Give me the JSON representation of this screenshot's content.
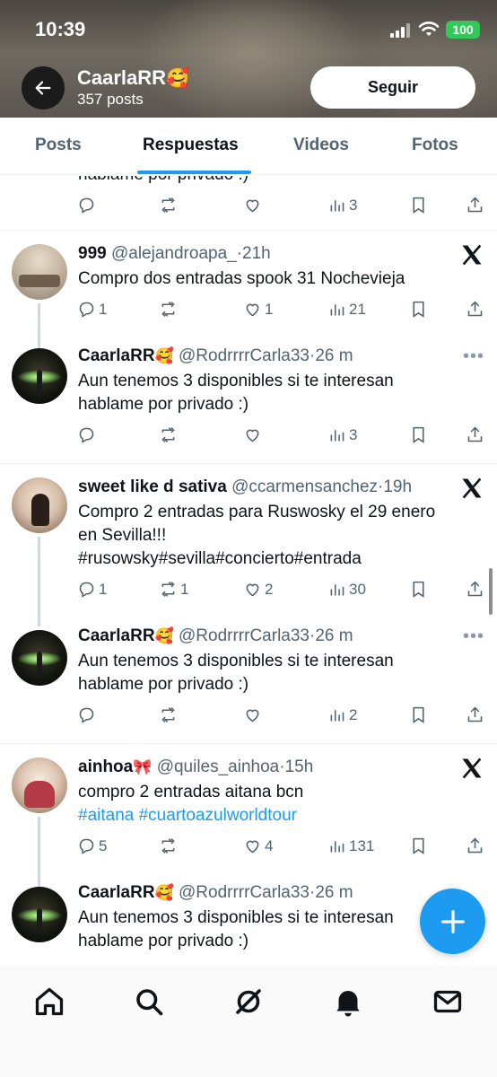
{
  "status_bar": {
    "time": "10:39",
    "battery": "100"
  },
  "profile": {
    "name": "CaarlaRR",
    "name_emoji": "🥰",
    "posts_count": "357 posts",
    "follow_label": "Seguir"
  },
  "tabs": [
    {
      "label": "Posts",
      "active": false
    },
    {
      "label": "Respuestas",
      "active": true
    },
    {
      "label": "Videos",
      "active": false
    },
    {
      "label": "Fotos",
      "active": false
    }
  ],
  "feed": {
    "top_partial": {
      "text": "hablame por privado :)",
      "views": "3"
    },
    "threads": [
      {
        "original": {
          "name": "999",
          "name_emoji": "",
          "handle": "@alejandroapa_",
          "time": "21h",
          "lines": [
            "Compro dos entradas spook 31 Nochevieja"
          ],
          "replies": "1",
          "reposts": "",
          "likes": "1",
          "views": "21"
        },
        "reply": {
          "name": "CaarlaRR",
          "name_emoji": "🥰",
          "handle": "@RodrrrrCarla33",
          "time": "26 m",
          "lines": [
            "Aun tenemos 3 disponibles si te interesan",
            "hablame por privado :)"
          ],
          "views": "3"
        }
      },
      {
        "original": {
          "name": "sweet like d sativa",
          "name_emoji": "",
          "handle": "@ccarmensanchez",
          "time": "19h",
          "lines": [
            "Compro 2 entradas para Ruswosky el 29 enero",
            "en Sevilla!!!",
            "#rusowsky#sevilla#concierto#entrada"
          ],
          "replies": "1",
          "reposts": "1",
          "likes": "2",
          "views": "30"
        },
        "reply": {
          "name": "CaarlaRR",
          "name_emoji": "🥰",
          "handle": "@RodrrrrCarla33",
          "time": "26 m",
          "lines": [
            "Aun tenemos 3 disponibles si te interesan",
            "hablame por privado :)"
          ],
          "views": "2"
        }
      },
      {
        "original": {
          "name": "ainhoa",
          "name_emoji": "🎀",
          "handle": "@quiles_ainhoa",
          "time": "15h",
          "lines": [
            "compro 2 entradas aitana bcn"
          ],
          "hashtags": "#aitana #cuartoazulworldtour",
          "replies": "5",
          "reposts": "",
          "likes": "4",
          "views": "131"
        },
        "reply": {
          "name": "CaarlaRR",
          "name_emoji": "🥰",
          "handle": "@RodrrrrCarla33",
          "time": "26 m",
          "lines": [
            "Aun tenemos 3 disponibles si te interesan",
            "hablame por privado :)"
          ]
        }
      }
    ]
  },
  "separator": "·",
  "more_label": "•••",
  "colors": {
    "accent": "#1d9bf0",
    "text_primary": "#0f1419",
    "text_secondary": "#536471",
    "battery": "#34c759"
  },
  "icons": [
    "back-arrow-icon",
    "reply-icon",
    "repost-icon",
    "like-icon",
    "views-icon",
    "bookmark-icon",
    "share-icon",
    "x-logo-icon",
    "more-icon",
    "compose-icon",
    "home-icon",
    "search-icon",
    "grok-icon",
    "notifications-icon",
    "messages-icon"
  ]
}
